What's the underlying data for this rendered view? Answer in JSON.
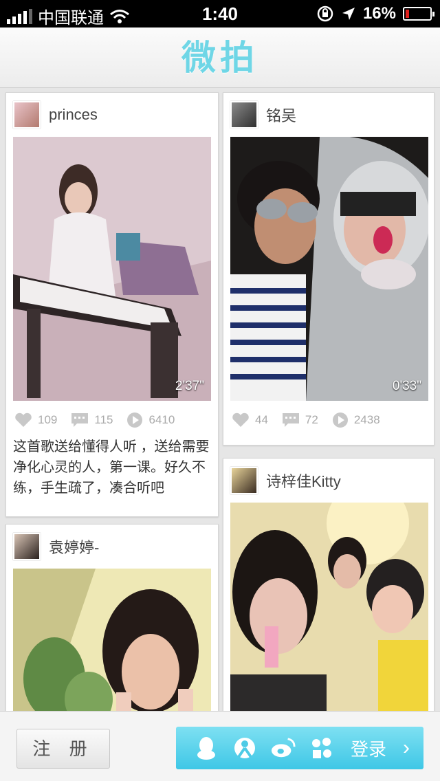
{
  "status_bar": {
    "carrier": "中国联通",
    "time": "1:40",
    "battery": "16%",
    "battery_level": 0.16
  },
  "header": {
    "title": "微拍"
  },
  "feed": [
    {
      "username": "princes",
      "duration": "2'37\"",
      "likes": "109",
      "comments": "115",
      "plays": "6410",
      "caption": "这首歌送给懂得人听 ，送给需要净化心灵的人，第一课。好久不练，手生疏了，凑合听吧"
    },
    {
      "username": "铭吴",
      "duration": "0'33\"",
      "likes": "44",
      "comments": "72",
      "plays": "2438"
    },
    {
      "username": "诗梓佳Kitty"
    },
    {
      "username": "袁婷婷-"
    }
  ],
  "bottom_bar": {
    "register_label": "注 册",
    "login_label": "登录",
    "login_icons": [
      "qq-icon",
      "people-icon",
      "weibo-icon",
      "renren-icon"
    ]
  },
  "colors": {
    "accent": "#4ecbe6",
    "header_title": "#6fd6e6",
    "stat_gray": "#aaaaaa"
  }
}
